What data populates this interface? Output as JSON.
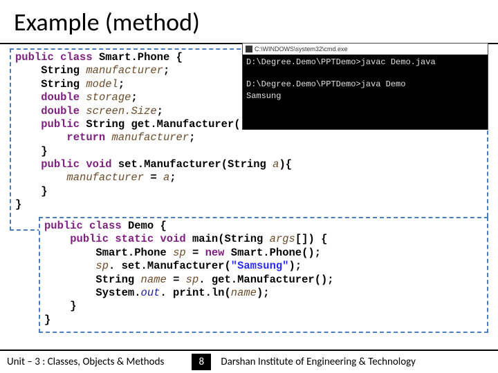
{
  "title": "Example (method)",
  "cmd": {
    "titlebar": "C:\\WINDOWS\\system32\\cmd.exe",
    "line1": "D:\\Degree.Demo\\PPTDemo>javac Demo.java",
    "line2": "D:\\Degree.Demo\\PPTDemo>java Demo",
    "line3": "Samsung"
  },
  "code1": {
    "l1a": "public",
    "l1b": "class",
    "l1c": "Smart.Phone {",
    "l2a": "String",
    "l2b": "manufacturer",
    "l2c": ";",
    "l3a": "String",
    "l3b": "model",
    "l3c": ";",
    "l4a": "double",
    "l4b": "storage",
    "l4c": ";",
    "l5a": "double",
    "l5b": "screen.Size",
    "l5c": ";",
    "l6a": "public",
    "l6b": "String get.Manufacturer(){",
    "l7a": "return",
    "l7b": "manufacturer",
    "l7c": ";",
    "l8": "}",
    "l9a": "public",
    "l9b": "void",
    "l9c": "set.Manufacturer(String",
    "l9d": "a",
    "l9e": "){",
    "l10a": "manufacturer",
    "l10b": " = ",
    "l10c": "a",
    "l10d": ";",
    "l11": "}",
    "l12": "}"
  },
  "code2": {
    "l1a": "public",
    "l1b": "class",
    "l1c": "Demo {",
    "l2a": "public",
    "l2b": "static",
    "l2c": "void",
    "l2d": "main(String",
    "l2e": "args",
    "l2f": "[]) {",
    "l3a": "Smart.Phone",
    "l3b": "sp",
    "l3c": " = ",
    "l3d": "new",
    "l3e": "Smart.Phone();",
    "l4a": "sp",
    "l4b": ". set.Manufacturer(",
    "l4c": "\"Samsung\"",
    "l4d": ");",
    "l5a": "String",
    "l5b": "name",
    "l5c": " = ",
    "l5d": "sp",
    "l5e": ". get.Manufacturer();",
    "l6a": "System.",
    "l6b": "out",
    "l6c": ". print.ln(",
    "l6d": "name",
    "l6e": ");",
    "l7": "}",
    "l8": "}"
  },
  "footer": {
    "left": "Unit – 3  : Classes, Objects & Methods",
    "page": "8",
    "right": "Darshan Institute of Engineering & Technology"
  }
}
